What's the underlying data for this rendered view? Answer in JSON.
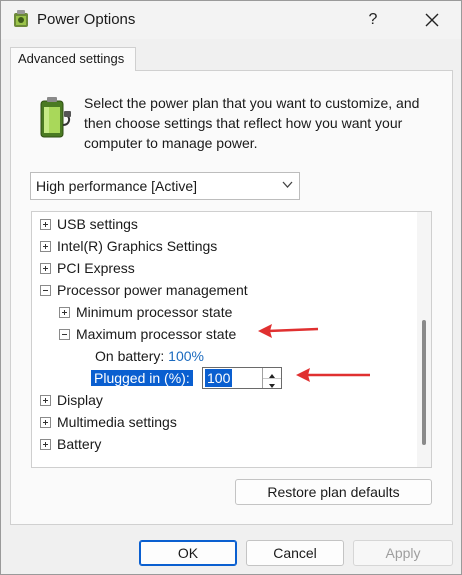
{
  "window": {
    "title": "Power Options",
    "help_glyph": "?",
    "icons": [
      "power-options-icon",
      "help-icon",
      "close-icon"
    ]
  },
  "tab": {
    "label": "Advanced settings"
  },
  "intro": {
    "text": "Select the power plan that you want to customize, and then choose settings that reflect how you want your computer to manage power.",
    "icon": "battery-plug-icon"
  },
  "plan": {
    "selected": "High performance [Active]"
  },
  "tree": {
    "usb": "USB settings",
    "intel": "Intel(R) Graphics Settings",
    "pci": "PCI Express",
    "ppm": "Processor power management",
    "min_state": "Minimum processor state",
    "max_state": "Maximum processor state",
    "on_battery_label": "On battery:",
    "on_battery_value": "100%",
    "plugged_label": "Plugged in (%):",
    "plugged_value": "100",
    "display": "Display",
    "multimedia": "Multimedia settings",
    "battery": "Battery"
  },
  "buttons": {
    "restore": "Restore plan defaults",
    "ok": "OK",
    "cancel": "Cancel",
    "apply": "Apply"
  },
  "colors": {
    "accent": "#0a5fd0",
    "link": "#1c6bbf",
    "annotation_arrow": "#e03030"
  }
}
